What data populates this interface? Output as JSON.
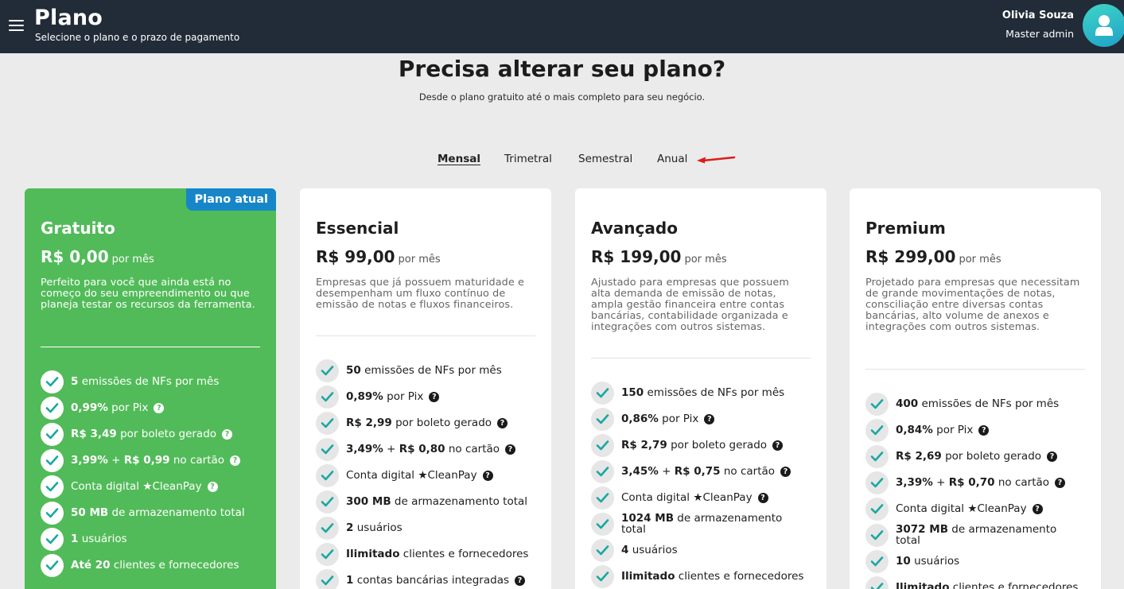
{
  "header": {
    "title": "Plano",
    "subtitle": "Selecione o plano e o prazo de pagamento",
    "user_name": "Olivia Souza",
    "user_role": "Master admin"
  },
  "hero": {
    "title": "Precisa alterar seu plano?",
    "subtitle": "Desde o plano gratuito até o mais completo para seu negócio."
  },
  "tabs": [
    {
      "label": "Mensal",
      "active": true
    },
    {
      "label": "Trimetral",
      "active": false
    },
    {
      "label": "Semestral",
      "active": false
    },
    {
      "label": "Anual",
      "active": false
    }
  ],
  "colors": {
    "header_bg": "#222b38",
    "current_plan_bg": "#52bb59",
    "badge_bg": "#1686c9",
    "check_color": "#1aa8a0",
    "annotation_arrow": "#e01a1a"
  },
  "plans": [
    {
      "badge": "Plano atual",
      "name": "Gratuito",
      "price": "R$ 0,00",
      "period": "por mês",
      "description": "Perfeito para você que ainda está no começo do seu empreendimento ou que planeja testar os recursos da ferramenta.",
      "features": [
        {
          "bold": "5",
          "text": "emissões de NFs por mês"
        },
        {
          "bold": "0,99%",
          "text": "por Pix"
        },
        {
          "bold": "R$ 3,49",
          "text": "por boleto gerado"
        },
        {
          "bold": "3,99%",
          "mid": " + ",
          "bold2": "R$ 0,99",
          "text": "no cartão"
        },
        {
          "bold": "",
          "text": "Conta digital ★CleanPay"
        },
        {
          "bold": "50 MB",
          "text": "de armazenamento total"
        },
        {
          "bold": "1",
          "text": "usuários"
        },
        {
          "bold": "Até 20",
          "text": "clientes e fornecedores"
        }
      ]
    },
    {
      "name": "Essencial",
      "price": "R$ 99,00",
      "period": "por mês",
      "description": "Empresas que já possuem maturidade e desempenham um fluxo contínuo de emissão de notas e fluxos financeiros.",
      "features": [
        {
          "bold": "50",
          "text": "emissões de NFs por mês"
        },
        {
          "bold": "0,89%",
          "text": "por Pix"
        },
        {
          "bold": "R$ 2,99",
          "text": "por boleto gerado"
        },
        {
          "bold": "3,49%",
          "mid": " + ",
          "bold2": "R$ 0,80",
          "text": "no cartão"
        },
        {
          "bold": "",
          "text": "Conta digital ★CleanPay"
        },
        {
          "bold": "300 MB",
          "text": "de armazenamento total"
        },
        {
          "bold": "2",
          "text": "usuários"
        },
        {
          "bold": "Ilimitado",
          "text": "clientes e fornecedores"
        },
        {
          "bold": "1",
          "text": "contas bancárias integradas"
        }
      ]
    },
    {
      "name": "Avançado",
      "price": "R$ 199,00",
      "period": "por mês",
      "description": "Ajustado para empresas que possuem alta demanda de emissão de notas, ampla gestão financeira entre contas bancárias, contabilidade organizada e integrações com outros sistemas.",
      "features": [
        {
          "bold": "150",
          "text": "emissões de NFs por mês"
        },
        {
          "bold": "0,86%",
          "text": "por Pix"
        },
        {
          "bold": "R$ 2,79",
          "text": "por boleto gerado"
        },
        {
          "bold": "3,45%",
          "mid": " + ",
          "bold2": "R$ 0,75",
          "text": "no cartão"
        },
        {
          "bold": "",
          "text": "Conta digital ★CleanPay"
        },
        {
          "bold": "1024 MB",
          "text": "de armazenamento total"
        },
        {
          "bold": "4",
          "text": "usuários"
        },
        {
          "bold": "Ilimitado",
          "text": "clientes e fornecedores"
        }
      ]
    },
    {
      "name": "Premium",
      "price": "R$ 299,00",
      "period": "por mês",
      "description": "Projetado para empresas que necessitam de grande movimentações de notas, consciliação entre diversas contas bancárias, alto volume de anexos e integrações com outros sistemas.",
      "features": [
        {
          "bold": "400",
          "text": "emissões de NFs por mês"
        },
        {
          "bold": "0,84%",
          "text": "por Pix"
        },
        {
          "bold": "R$ 2,69",
          "text": "por boleto gerado"
        },
        {
          "bold": "3,39%",
          "mid": " + ",
          "bold2": "R$ 0,70",
          "text": "no cartão"
        },
        {
          "bold": "",
          "text": "Conta digital ★CleanPay"
        },
        {
          "bold": "3072 MB",
          "text": "de armazenamento total"
        },
        {
          "bold": "10",
          "text": "usuários"
        },
        {
          "bold": "Ilimitado",
          "text": "clientes e fornecedores"
        }
      ]
    }
  ]
}
